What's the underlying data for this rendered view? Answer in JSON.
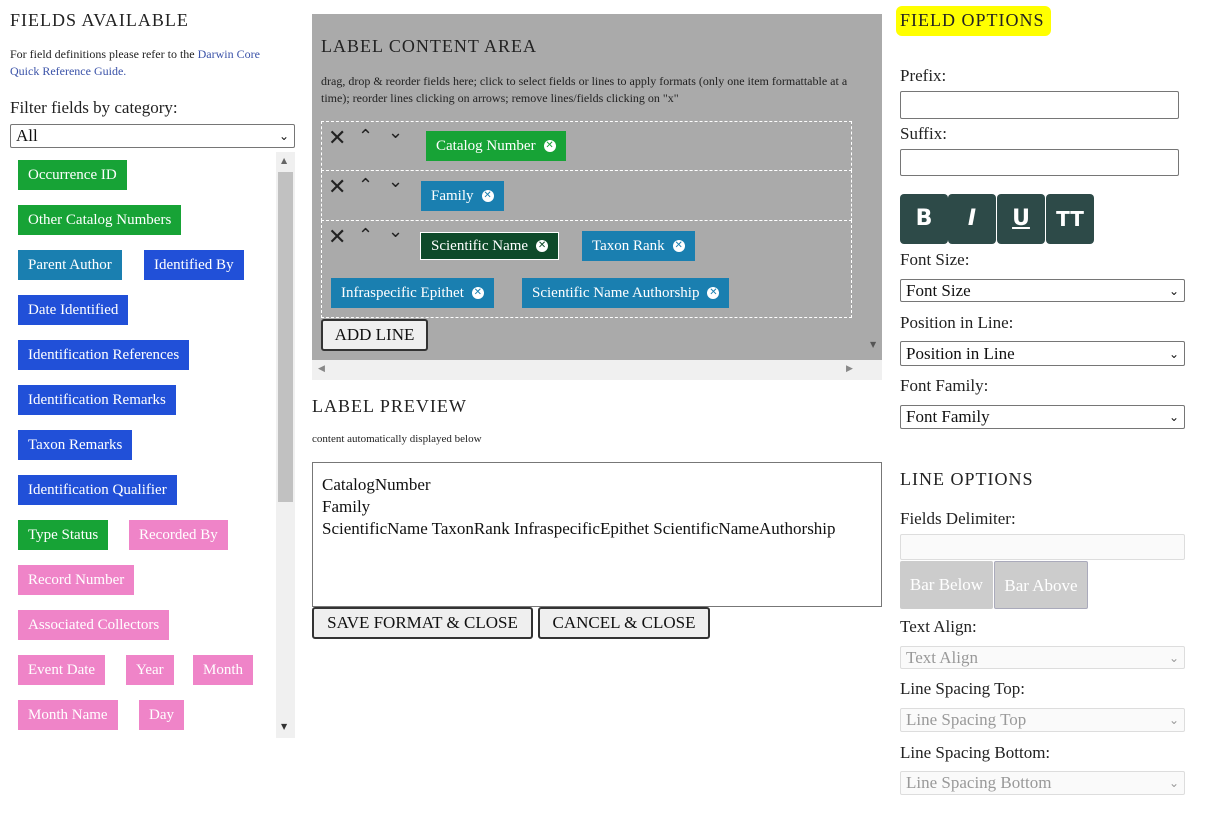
{
  "left": {
    "title": "FIELDS AVAILABLE",
    "help_prefix": "For field definitions please refer to the",
    "help_link": "Darwin Core Quick Reference Guide.",
    "filter_label": "Filter fields by category:",
    "filter_value": "All",
    "fields": [
      {
        "label": "Occurrence ID",
        "color": "green"
      },
      {
        "label": "Other Catalog Numbers",
        "color": "green"
      },
      {
        "label": "Parent Author",
        "color": "teal"
      },
      {
        "label": "Identified By",
        "color": "blue"
      },
      {
        "label": "Date Identified",
        "color": "blue"
      },
      {
        "label": "Identification References",
        "color": "blue"
      },
      {
        "label": "Identification Remarks",
        "color": "blue"
      },
      {
        "label": "Taxon Remarks",
        "color": "blue"
      },
      {
        "label": "Identification Qualifier",
        "color": "blue"
      },
      {
        "label": "Type Status",
        "color": "green"
      },
      {
        "label": "Recorded By",
        "color": "pink"
      },
      {
        "label": "Record Number",
        "color": "pink"
      },
      {
        "label": "Associated Collectors",
        "color": "pink"
      },
      {
        "label": "Event Date",
        "color": "pink"
      },
      {
        "label": "Year",
        "color": "pink"
      },
      {
        "label": "Month",
        "color": "pink"
      },
      {
        "label": "Month Name",
        "color": "pink"
      },
      {
        "label": "Day",
        "color": "pink"
      }
    ]
  },
  "content_area": {
    "title": "LABEL CONTENT AREA",
    "instructions": "drag, drop & reorder fields here; click to select fields or lines to apply formats (only one item formattable at a time); reorder lines clicking on arrows; remove lines/fields clicking on \"x\"",
    "lines": [
      {
        "fields": [
          "Catalog Number"
        ]
      },
      {
        "fields": [
          "Family"
        ]
      },
      {
        "fields": [
          "Scientific Name",
          "Taxon Rank",
          "Infraspecific Epithet",
          "Scientific Name Authorship"
        ]
      }
    ],
    "add_line_label": "ADD LINE"
  },
  "preview": {
    "title": "LABEL PREVIEW",
    "subtitle": "content automatically displayed below",
    "lines": [
      "CatalogNumber",
      "Family",
      "ScientificName TaxonRank InfraspecificEpithet ScientificNameAuthorship"
    ],
    "save_label": "SAVE FORMAT & CLOSE",
    "cancel_label": "CANCEL & CLOSE"
  },
  "field_options": {
    "title": "FIELD OPTIONS",
    "highlight_color": "#ffff00",
    "prefix_label": "Prefix:",
    "suffix_label": "Suffix:",
    "format_buttons": [
      "B",
      "I",
      "U",
      "TT"
    ],
    "font_size_label": "Font Size:",
    "font_size_value": "Font Size",
    "position_label": "Position in Line:",
    "position_value": "Position in Line",
    "font_family_label": "Font Family:",
    "font_family_value": "Font Family"
  },
  "line_options": {
    "title": "LINE OPTIONS",
    "delimiter_label": "Fields Delimiter:",
    "bar_below_label": "Bar Below",
    "bar_above_label": "Bar Above",
    "text_align_label": "Text Align:",
    "text_align_value": "Text Align",
    "spacing_top_label": "Line Spacing Top:",
    "spacing_top_value": "Line Spacing Top",
    "spacing_bottom_label": "Line Spacing Bottom:",
    "spacing_bottom_value": "Line Spacing Bottom"
  }
}
